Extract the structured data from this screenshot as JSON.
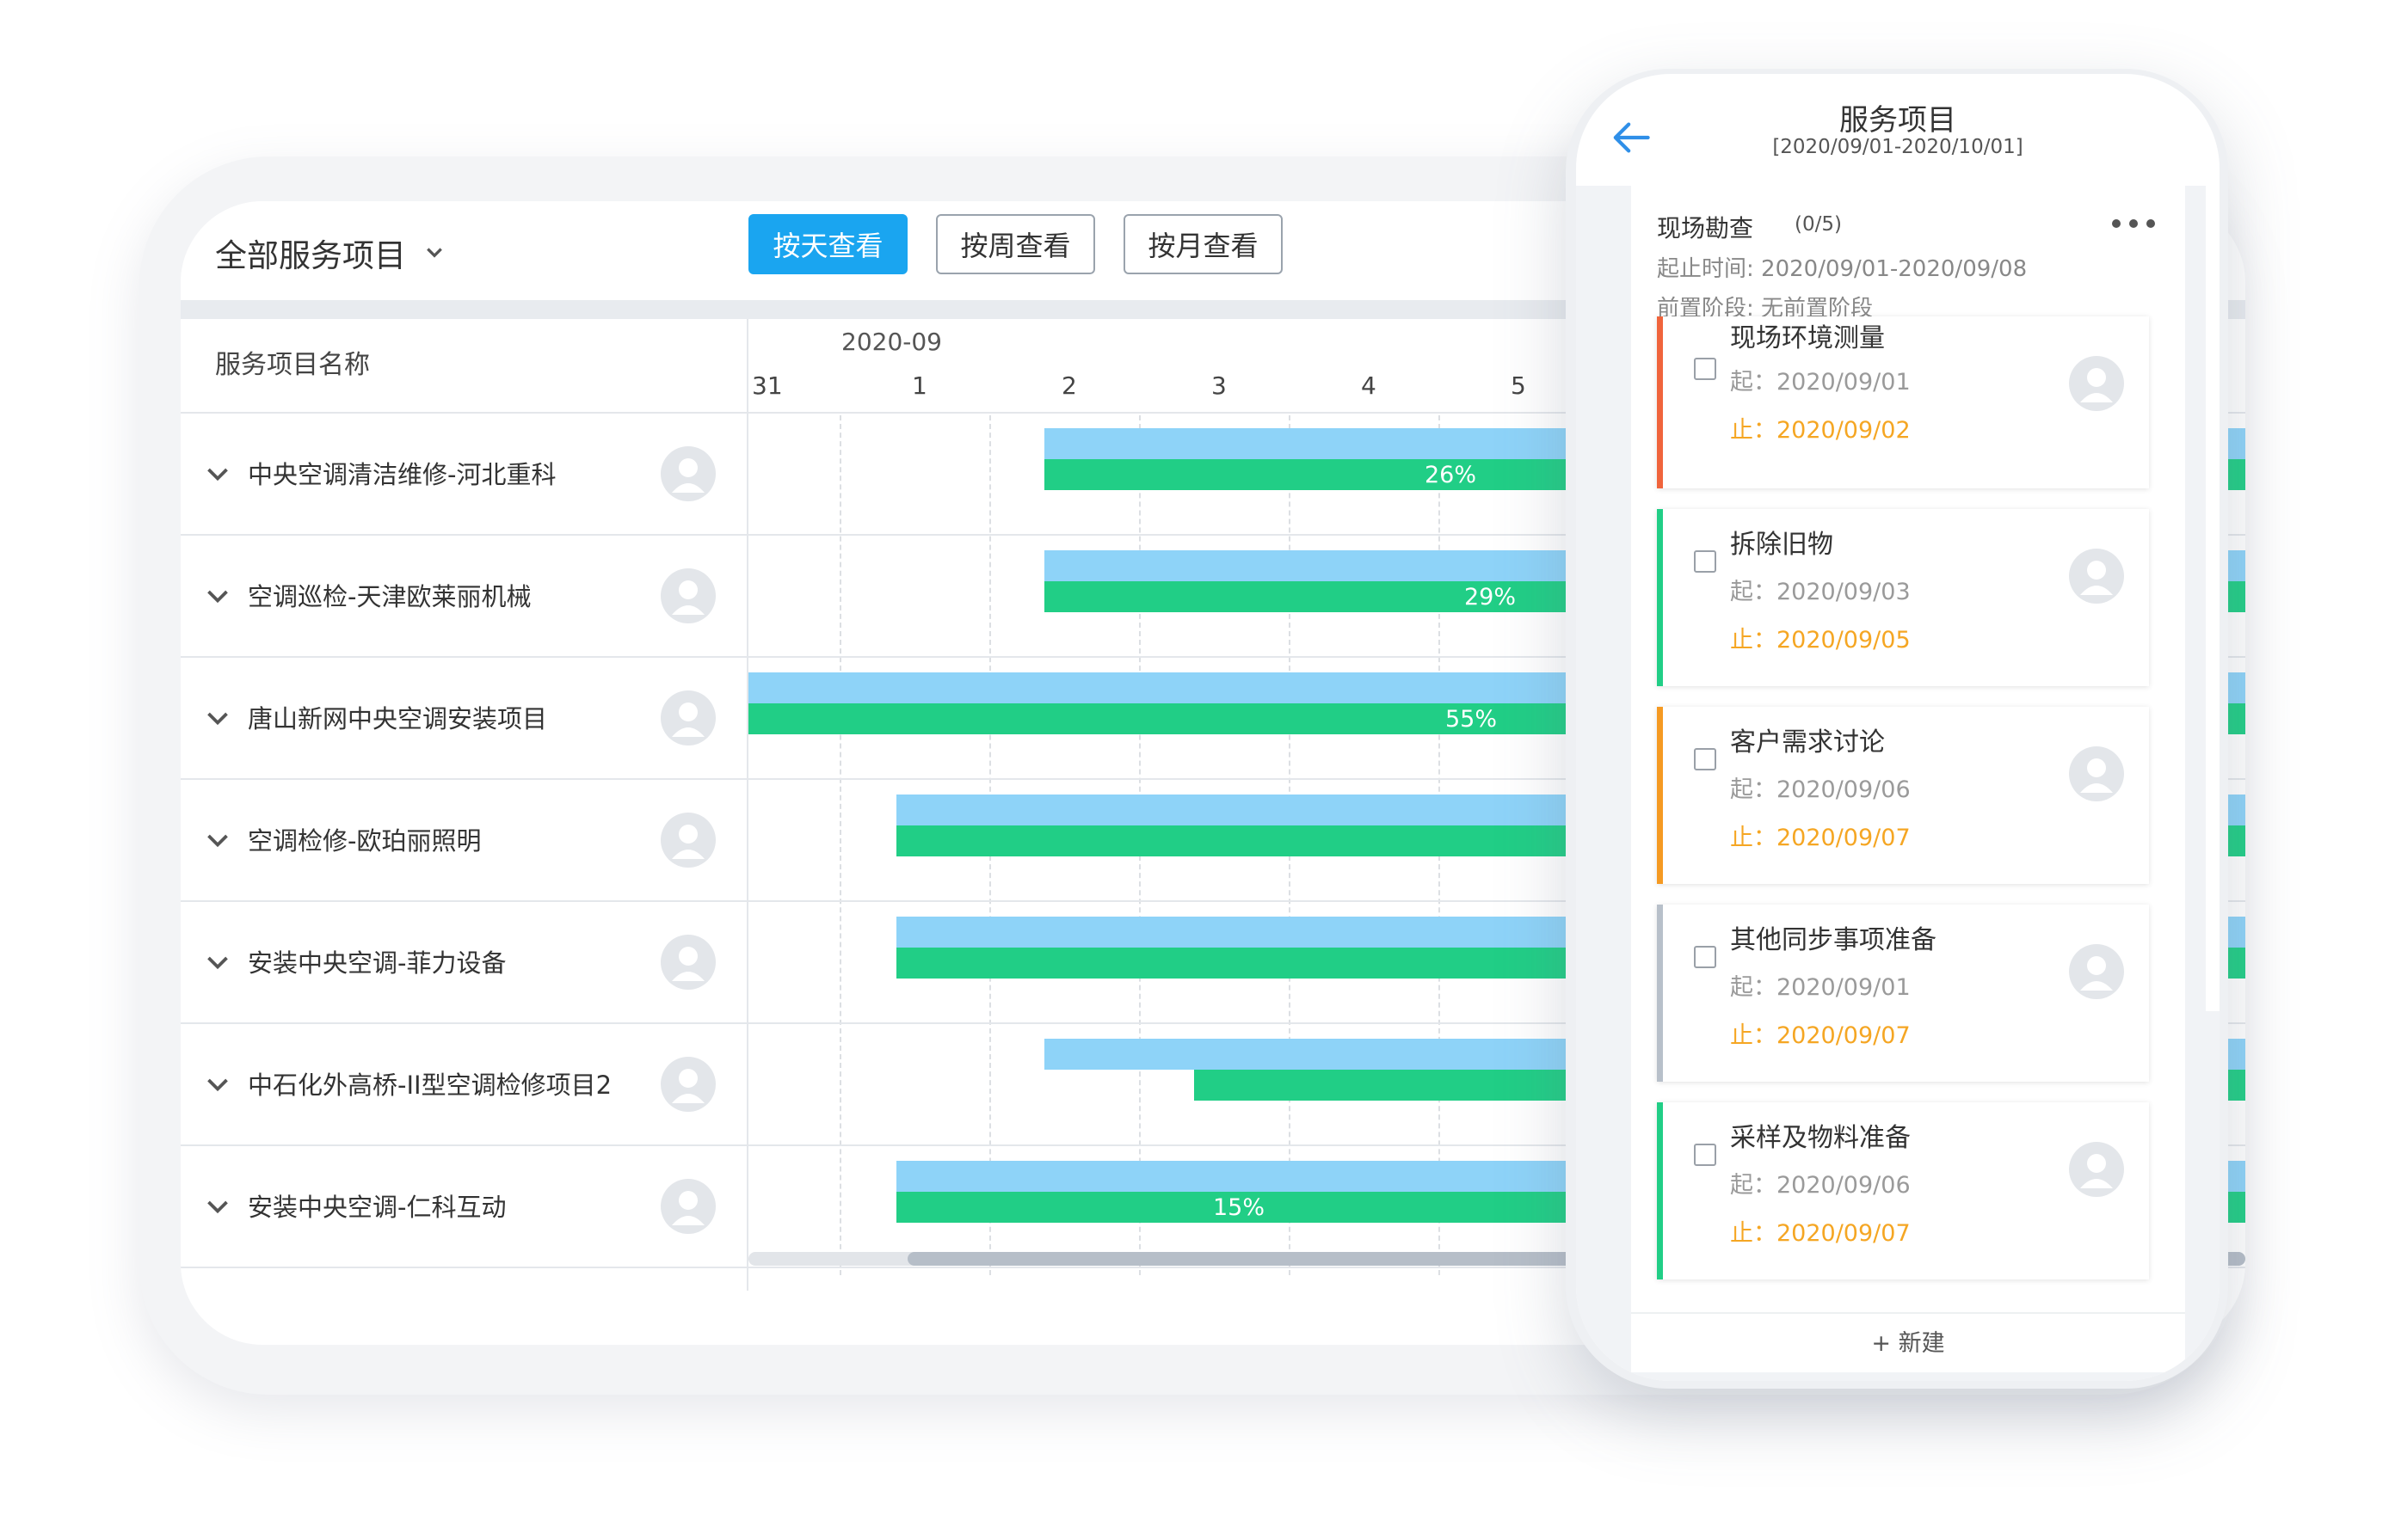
{
  "tablet": {
    "project_selector": "全部服务项目",
    "view_buttons": [
      "按天查看",
      "按周查看",
      "按月查看"
    ],
    "column_title": "服务项目名称",
    "month": "2020-09",
    "days": [
      "31",
      "1",
      "2",
      "3",
      "4",
      "5"
    ],
    "rows": [
      {
        "name": "中央空调清洁维修-河北重科",
        "progress": "26%"
      },
      {
        "name": "空调巡检-天津欧莱丽机械",
        "progress": "29%"
      },
      {
        "name": "唐山新网中央空调安装项目",
        "progress": "55%"
      },
      {
        "name": "空调检修-欧珀丽照明",
        "progress": ""
      },
      {
        "name": "安装中央空调-菲力设备",
        "progress": ""
      },
      {
        "name": "中石化外高桥-II型空调检修项目2",
        "progress": ""
      },
      {
        "name": "安装中央空调-仁科互动",
        "progress": "15%"
      }
    ],
    "colors": {
      "primary": "#1aa5f0",
      "plan_bar": "#8ed3f8",
      "actual_bar": "#21ce86"
    }
  },
  "phone": {
    "title": "服务项目",
    "subtitle": "[2020/09/01-2020/10/01]",
    "stage": {
      "name": "现场勘查",
      "count": "(0/5)",
      "period": "起止时间: 2020/09/01-2020/09/08",
      "prereq": "前置阶段: 无前置阶段"
    },
    "start_label": "起：",
    "end_label": "止：",
    "tasks": [
      {
        "name": "现场环境测量",
        "start": "2020/09/01",
        "end": "2020/09/02",
        "color": "#f0643c"
      },
      {
        "name": "拆除旧物",
        "start": "2020/09/03",
        "end": "2020/09/05",
        "color": "#21ce86"
      },
      {
        "name": "客户需求讨论",
        "start": "2020/09/06",
        "end": "2020/09/07",
        "color": "#f59a23"
      },
      {
        "name": "其他同步事项准备",
        "start": "2020/09/01",
        "end": "2020/09/07",
        "color": "#b8c0ca"
      },
      {
        "name": "采样及物料准备",
        "start": "2020/09/06",
        "end": "2020/09/07",
        "color": "#21ce86"
      }
    ],
    "new_label": "+ 新建"
  }
}
